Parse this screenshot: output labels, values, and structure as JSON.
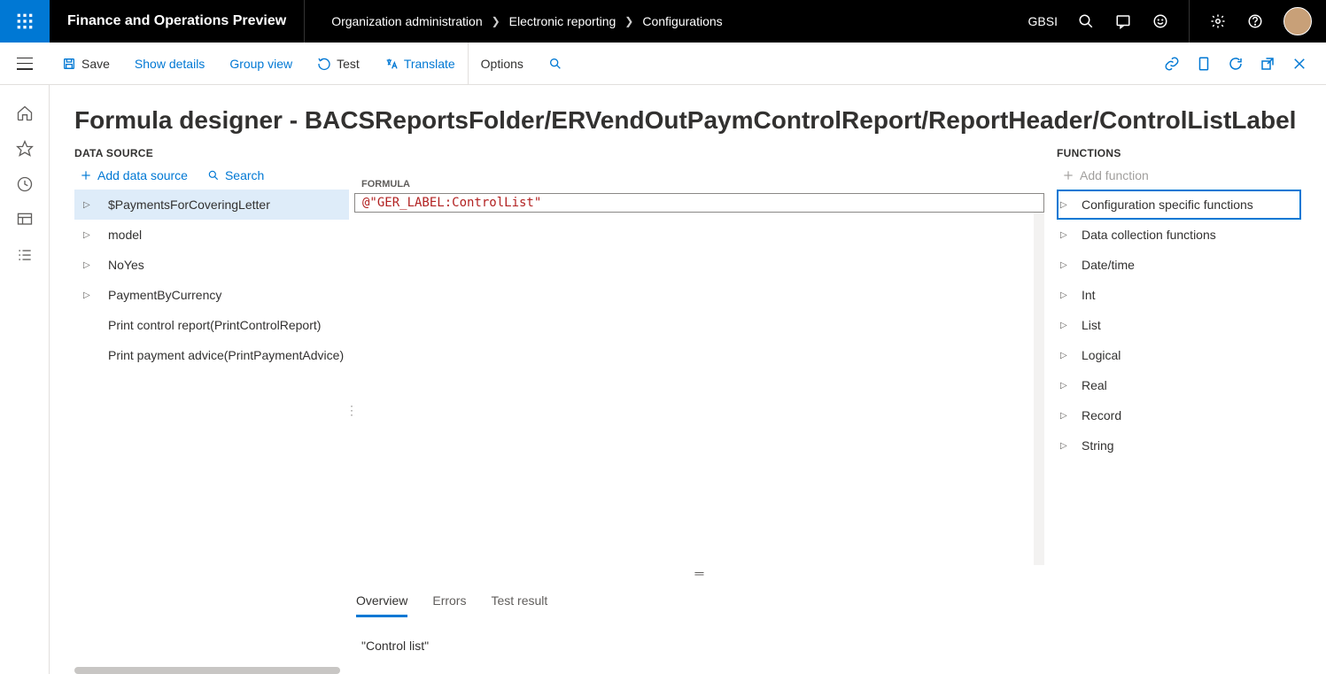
{
  "header": {
    "appTitle": "Finance and Operations Preview",
    "breadcrumb": [
      "Organization administration",
      "Electronic reporting",
      "Configurations"
    ],
    "company": "GBSI"
  },
  "actions": {
    "save": "Save",
    "showDetails": "Show details",
    "groupView": "Group view",
    "test": "Test",
    "translate": "Translate",
    "options": "Options"
  },
  "page": {
    "title": "Formula designer - BACSReportsFolder/ERVendOutPaymControlReport/ReportHeader/ControlListLabel"
  },
  "dataSource": {
    "header": "DATA SOURCE",
    "addLabel": "Add data source",
    "searchLabel": "Search",
    "items": [
      {
        "label": "$PaymentsForCoveringLetter",
        "expandable": true,
        "selected": true
      },
      {
        "label": "model",
        "expandable": true
      },
      {
        "label": "NoYes",
        "expandable": true
      },
      {
        "label": "PaymentByCurrency",
        "expandable": true
      },
      {
        "label": "Print control report(PrintControlReport)",
        "expandable": false
      },
      {
        "label": "Print payment advice(PrintPaymentAdvice)",
        "expandable": false
      }
    ]
  },
  "formula": {
    "header": "FORMULA",
    "expression": "@\"GER_LABEL:ControlList\""
  },
  "tabs": {
    "overview": "Overview",
    "errors": "Errors",
    "testResult": "Test result",
    "overviewBody": "\"Control list\""
  },
  "functions": {
    "header": "FUNCTIONS",
    "addLabel": "Add function",
    "items": [
      {
        "label": "Configuration specific functions",
        "selected": true
      },
      {
        "label": "Data collection functions"
      },
      {
        "label": "Date/time"
      },
      {
        "label": "Int"
      },
      {
        "label": "List"
      },
      {
        "label": "Logical"
      },
      {
        "label": "Real"
      },
      {
        "label": "Record"
      },
      {
        "label": "String"
      }
    ]
  }
}
